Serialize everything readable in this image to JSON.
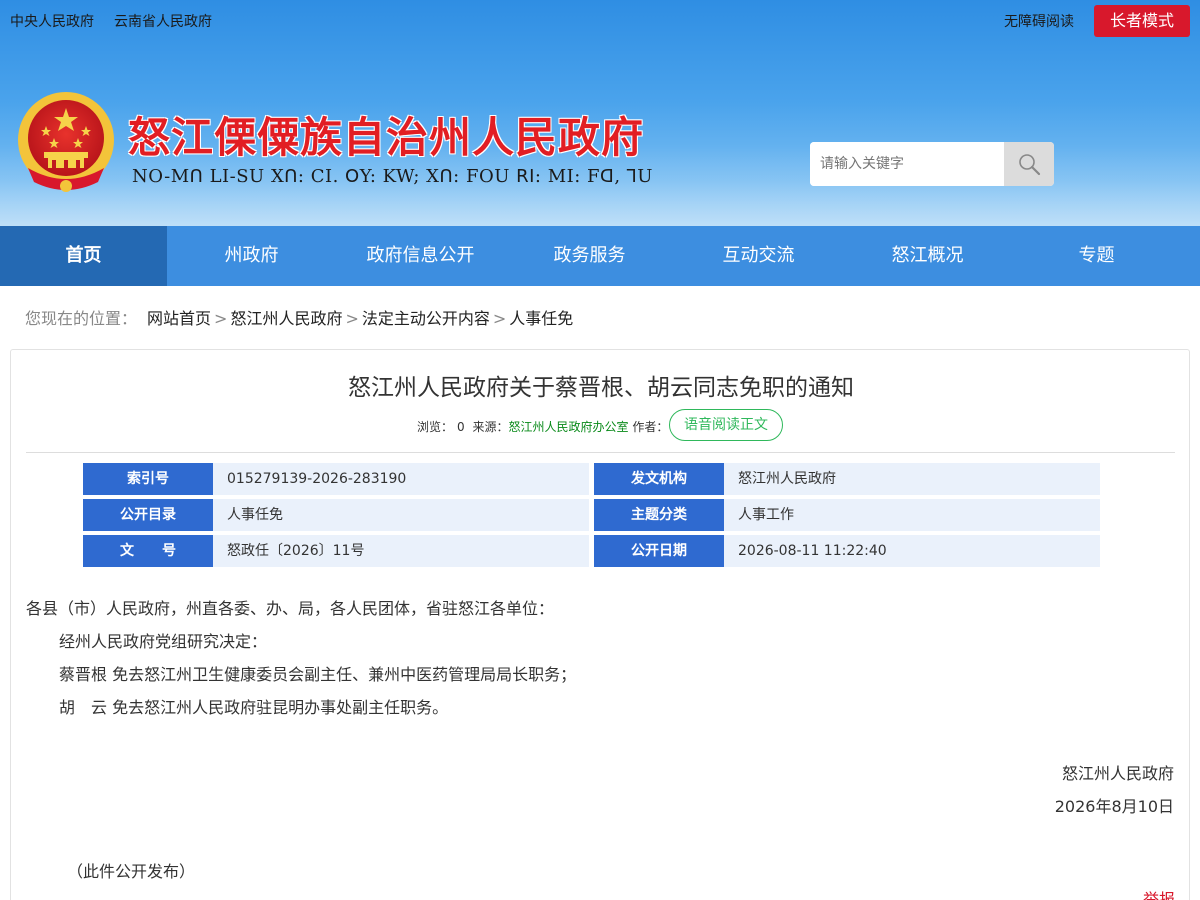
{
  "topbar": {
    "links": [
      "中央人民政府",
      "云南省人民政府"
    ],
    "accessible": "无障碍阅读",
    "elder_mode": "长者模式"
  },
  "header": {
    "title": "怒江傈僳族自治州人民政府",
    "subtitle": "NO-Mꓵ LI-SU Xꓵ: CI. ꓳY: KW; Xꓵ: FOU ꓣꓲ: MI: Fꓷ, ꓶU"
  },
  "search": {
    "placeholder": "请输入关键字"
  },
  "nav": [
    "首页",
    "州政府",
    "政府信息公开",
    "政务服务",
    "互动交流",
    "怒江概况",
    "专题"
  ],
  "breadcrumb": {
    "label": "您现在的位置：",
    "items": [
      "网站首页",
      "怒江州人民政府",
      "法定主动公开内容",
      "人事任免"
    ],
    "sep": ">"
  },
  "article": {
    "title": "怒江州人民政府关于蔡晋根、胡云同志免职的通知",
    "views_label": "浏览：",
    "views": "0",
    "source_label": "来源：",
    "source": "怒江州人民政府办公室",
    "author_label": "作者：",
    "tts": "语音阅读正文"
  },
  "info": {
    "index_label": "索引号",
    "index": "015279139-2026-283190",
    "issuer_label": "发文机构",
    "issuer": "怒江州人民政府",
    "catalog_label": "公开目录",
    "catalog": "人事任免",
    "topic_label": "主题分类",
    "topic": "人事工作",
    "docno_label": "文　　号",
    "docno": "怒政任〔2026〕11号",
    "date_label": "公开日期",
    "date": "2026-08-11 11:22:40"
  },
  "body": {
    "salutation": "各县（市）人民政府，州直各委、办、局，各人民团体，省驻怒江各单位：",
    "p1": "经州人民政府党组研究决定：",
    "p2": "蔡晋根  免去怒江州卫生健康委员会副主任、兼州中医药管理局局长职务；",
    "p3": "胡　云  免去怒江州人民政府驻昆明办事处副主任职务。",
    "signature": "怒江州人民政府",
    "sign_date": "2026年8月10日",
    "note": "（此件公开发布）",
    "report": "举报"
  }
}
